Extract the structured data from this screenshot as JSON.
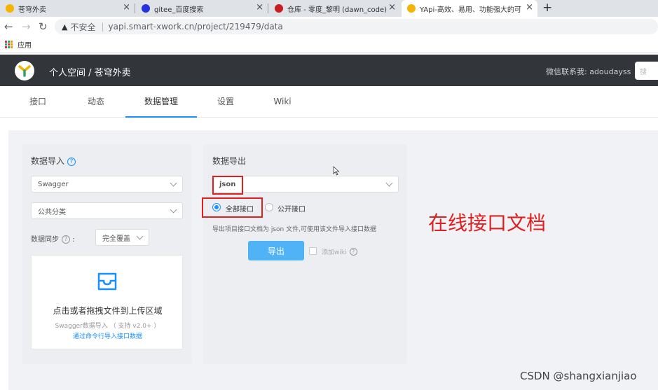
{
  "browser": {
    "tabs": [
      {
        "title": "苍穹外卖",
        "favicon_color": "#f5b400"
      },
      {
        "title": "gitee_百度搜索",
        "favicon_color": "#2932e1"
      },
      {
        "title": "仓库 - 零度_黎明 (dawn_code) -",
        "favicon_color": "#c71d23"
      },
      {
        "title": "YApi-高效、易用、功能强大的可",
        "favicon_color": "#f5b400"
      }
    ],
    "close_glyph": "×",
    "new_tab_glyph": "+",
    "insecure_label": "不安全",
    "url": "yapi.smart-xwork.cn/project/219479/data",
    "bookmarks_apps_label": "应用"
  },
  "app": {
    "breadcrumb": "个人空间 / 苍穹外卖",
    "contact": "微信联系我: adoudayss",
    "search_placeholder": "搜",
    "nav_tabs": [
      {
        "label": "接口",
        "active": false
      },
      {
        "label": "动态",
        "active": false
      },
      {
        "label": "数据管理",
        "active": true
      },
      {
        "label": "设置",
        "active": false
      },
      {
        "label": "Wiki",
        "active": false
      }
    ]
  },
  "import_card": {
    "title": "数据导入",
    "help": "?",
    "source_select": "Swagger",
    "category_select": "公共分类",
    "sync_label": "数据同步",
    "sync_select": "完全覆盖",
    "upload_main": "点击或者拖拽文件到上传区域",
    "upload_sub": "Swagger数据导入 （ 支持 v2.0+ ）",
    "upload_link": "通过命令行导入接口数据"
  },
  "export_card": {
    "title": "数据导出",
    "format_select": "json",
    "radio_all": "全部接口",
    "radio_public": "公开接口",
    "radio_selected": "all",
    "description": "导出项目接口文档为 json 文件,可使用该文件导入接口数据",
    "export_button": "导出",
    "add_wiki_label": "添加wiki"
  },
  "annotation": "在线接口文档",
  "watermark": "CSDN @shangxianjiao",
  "colors": {
    "accent": "#1890ff",
    "header_bg": "#32363a",
    "annotation_red": "#e02020",
    "export_button": "#4fb3f6"
  }
}
